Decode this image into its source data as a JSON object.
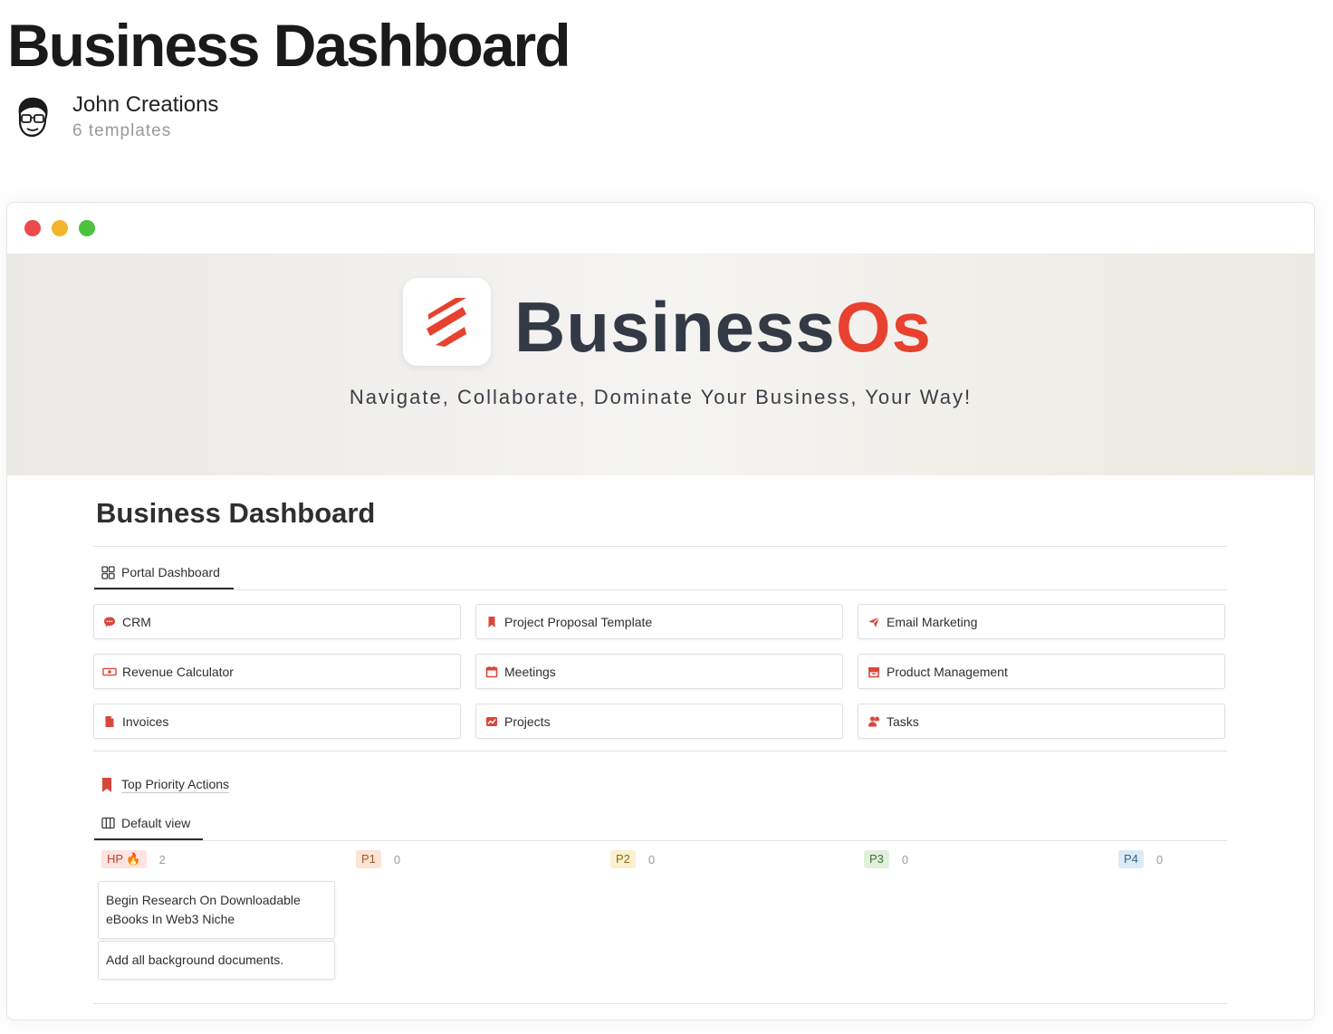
{
  "page": {
    "title": "Business Dashboard",
    "author_name": "John Creations",
    "author_templates": "6 templates"
  },
  "banner": {
    "brand_part1": "Business",
    "brand_part2": "Os",
    "tagline": "Navigate, Collaborate, Dominate Your Business, Your Way!"
  },
  "dashboard": {
    "title": "Business Dashboard",
    "tab_label": "Portal Dashboard",
    "links": [
      {
        "label": "CRM",
        "icon": "chat-bubble-icon"
      },
      {
        "label": "Project Proposal Template",
        "icon": "bookmark-icon"
      },
      {
        "label": "Email Marketing",
        "icon": "paper-plane-icon"
      },
      {
        "label": "Revenue Calculator",
        "icon": "cash-icon"
      },
      {
        "label": "Meetings",
        "icon": "calendar-icon"
      },
      {
        "label": "Product Management",
        "icon": "archive-box-icon"
      },
      {
        "label": "Invoices",
        "icon": "document-icon"
      },
      {
        "label": "Projects",
        "icon": "chart-icon"
      },
      {
        "label": "Tasks",
        "icon": "user-bell-icon"
      }
    ]
  },
  "priority": {
    "title": "Top Priority Actions",
    "view_label": "Default view",
    "columns": [
      {
        "label": "HP 🔥",
        "count": "2"
      },
      {
        "label": "P1",
        "count": "0"
      },
      {
        "label": "P2",
        "count": "0"
      },
      {
        "label": "P3",
        "count": "0"
      },
      {
        "label": "P4",
        "count": "0"
      }
    ],
    "tasks": [
      "Begin Research On Downloadable eBooks In Web3 Niche",
      "Add all background documents."
    ]
  },
  "colors": {
    "accent_red": "#e8412f",
    "brand_dark": "#333a45",
    "icon_red": "#d9473a"
  }
}
